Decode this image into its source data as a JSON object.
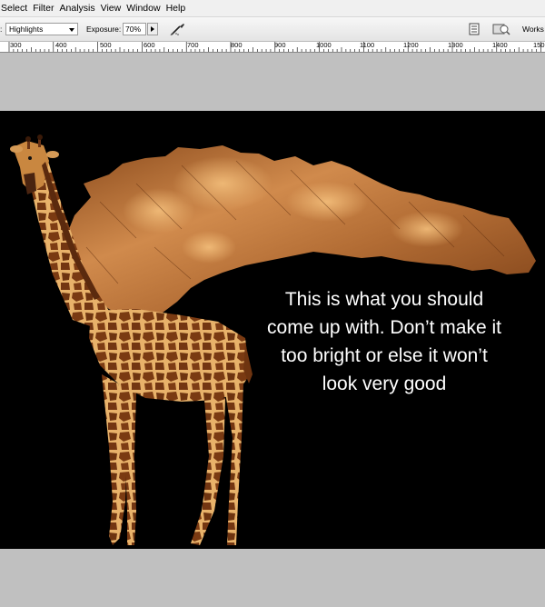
{
  "menu": {
    "items": [
      "Select",
      "Filter",
      "Analysis",
      "View",
      "Window",
      "Help"
    ]
  },
  "options": {
    "range_prefix": ":",
    "range_value": "Highlights",
    "exposure_label": "Exposure:",
    "exposure_value": "70%",
    "workspace_label": "Works"
  },
  "ruler": {
    "labels": [
      "300",
      "400",
      "500",
      "600",
      "700",
      "800",
      "900",
      "1000",
      "1100",
      "1200",
      "1300",
      "1400",
      "150"
    ]
  },
  "caption": {
    "line1": "This is what you should",
    "line2": "come up with. Don’t make it",
    "line3": "too bright or else it won’t",
    "line4": "look very good"
  },
  "icons": {
    "airbrush": "airbrush-icon",
    "doc": "document-icon",
    "launch": "launch-bridge-icon",
    "menu_arrow": "chevron-down-icon"
  }
}
